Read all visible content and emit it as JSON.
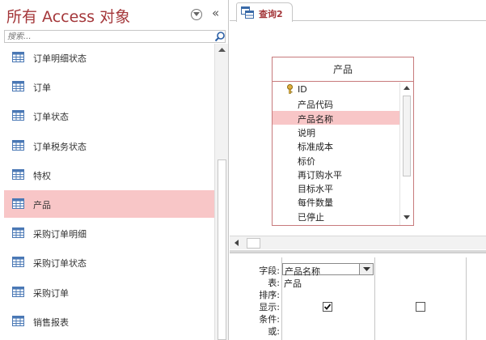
{
  "nav": {
    "title": "所有 Access 对象",
    "collapse_glyph": "«",
    "search_placeholder": "搜索...",
    "items": [
      {
        "label": "订单明细状态",
        "selected": false
      },
      {
        "label": "订单",
        "selected": false
      },
      {
        "label": "订单状态",
        "selected": false
      },
      {
        "label": "订单税务状态",
        "selected": false
      },
      {
        "label": "特权",
        "selected": false
      },
      {
        "label": "产品",
        "selected": true
      },
      {
        "label": "采购订单明细",
        "selected": false
      },
      {
        "label": "采购订单状态",
        "selected": false
      },
      {
        "label": "采购订单",
        "selected": false
      },
      {
        "label": "销售报表",
        "selected": false
      }
    ]
  },
  "tab": {
    "label": "查询2"
  },
  "field_list": {
    "title": "产品",
    "fields": [
      {
        "name": "ID",
        "key": true,
        "selected": false
      },
      {
        "name": "产品代码",
        "key": false,
        "selected": false
      },
      {
        "name": "产品名称",
        "key": false,
        "selected": true
      },
      {
        "name": "说明",
        "key": false,
        "selected": false
      },
      {
        "name": "标准成本",
        "key": false,
        "selected": false
      },
      {
        "name": "标价",
        "key": false,
        "selected": false
      },
      {
        "name": "再订购水平",
        "key": false,
        "selected": false
      },
      {
        "name": "目标水平",
        "key": false,
        "selected": false
      },
      {
        "name": "每件数量",
        "key": false,
        "selected": false
      },
      {
        "name": "已停止",
        "key": false,
        "selected": false
      }
    ]
  },
  "grid": {
    "labels": {
      "field": "字段:",
      "table": "表:",
      "sort": "排序:",
      "show": "显示:",
      "criteria": "条件:",
      "or": "或:"
    },
    "col1": {
      "field": "产品名称",
      "table": "产品",
      "show": true
    },
    "col2": {
      "show": false
    }
  },
  "colors": {
    "accent": "#a4373a",
    "selection": "#f8c6c7"
  }
}
